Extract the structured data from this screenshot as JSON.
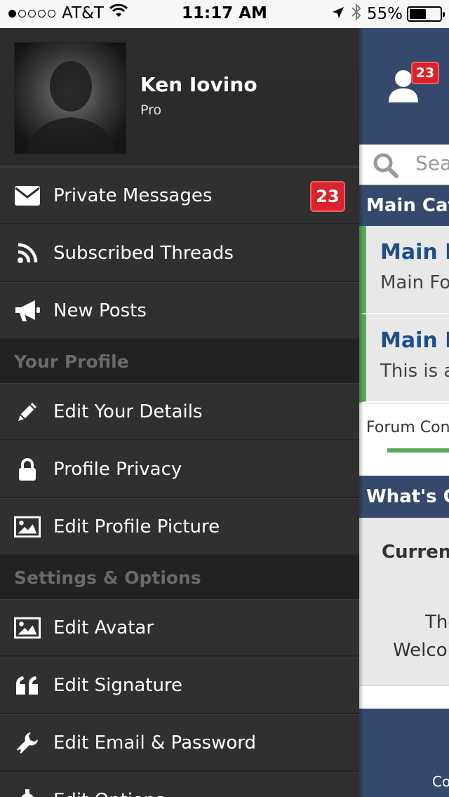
{
  "status_bar": {
    "carrier": "AT&T",
    "time": "11:17 AM",
    "battery": "55%",
    "battery_level": 0.55,
    "signal_bars": 1
  },
  "profile": {
    "name": "Ken Iovino",
    "rank": "Pro"
  },
  "menu": {
    "private_messages": {
      "label": "Private Messages",
      "badge": "23",
      "icon": "envelope-icon"
    },
    "subscribed_threads": {
      "label": "Subscribed Threads",
      "icon": "rss-icon"
    },
    "new_posts": {
      "label": "New Posts",
      "icon": "megaphone-icon"
    },
    "your_profile_header": "Your Profile",
    "edit_details": {
      "label": "Edit Your Details",
      "icon": "pencil-icon"
    },
    "profile_privacy": {
      "label": "Profile Privacy",
      "icon": "lock-icon"
    },
    "edit_profile_picture": {
      "label": "Edit Profile Picture",
      "icon": "picture-icon"
    },
    "settings_header": "Settings & Options",
    "edit_avatar": {
      "label": "Edit Avatar",
      "icon": "picture-icon"
    },
    "edit_signature": {
      "label": "Edit Signature",
      "icon": "quote-icon"
    },
    "edit_email_password": {
      "label": "Edit Email & Password",
      "icon": "wrench-icon"
    },
    "edit_options": {
      "label": "Edit Options",
      "icon": "gear-icon"
    }
  },
  "main": {
    "user_badge": "23",
    "search_placeholder": "Search",
    "category_title": "Main Category",
    "forums": [
      {
        "title": "Main Forum",
        "desc": "Main Forum"
      },
      {
        "title": "Main Forum",
        "desc": "This is a"
      }
    ],
    "controls_label": "Forum Controls",
    "whats_going_on": "What's Going On?",
    "currently_active": "Currently Active",
    "line_the": "The",
    "line_welcome": "Welcome",
    "footer_text": "Co"
  },
  "colors": {
    "sidebar_bg": "#303030",
    "section_bg": "#222222",
    "badge_red": "#d9222a",
    "navy": "#35496c",
    "forum_green": "#5aa65a",
    "link_blue": "#1f4f8a"
  }
}
